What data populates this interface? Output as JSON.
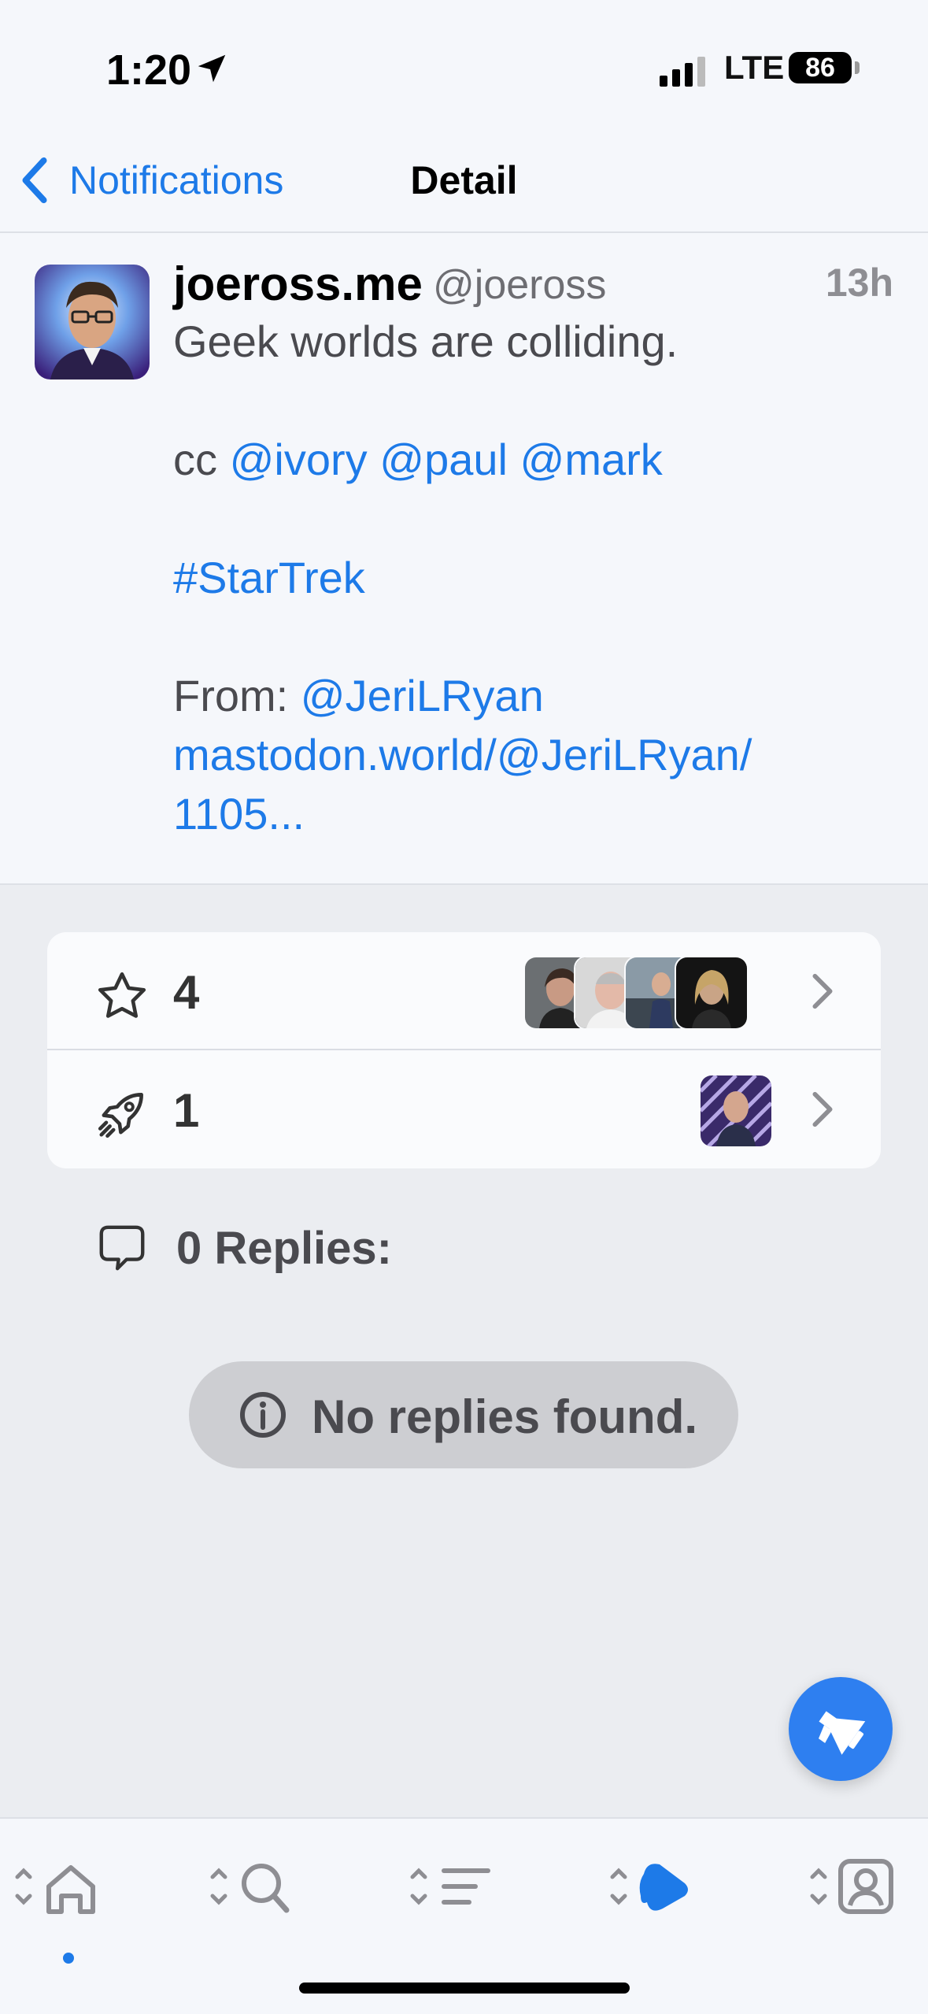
{
  "status_bar": {
    "time": "1:20",
    "network": "LTE",
    "battery": "86"
  },
  "nav": {
    "back_label": "Notifications",
    "title": "Detail"
  },
  "post": {
    "display_name": "joeross.me",
    "handle": "@joeross",
    "timestamp": "13h",
    "lines": [
      [
        {
          "text": "Geek worlds are colliding.",
          "link": false
        }
      ],
      [],
      [
        {
          "text": "cc ",
          "link": false
        },
        {
          "text": "@ivory",
          "link": true
        },
        {
          "text": " ",
          "link": false
        },
        {
          "text": "@paul",
          "link": true
        },
        {
          "text": " ",
          "link": false
        },
        {
          "text": "@mark",
          "link": true
        }
      ],
      [],
      [
        {
          "text": "#StarTrek",
          "link": true
        }
      ],
      [],
      [
        {
          "text": "From: ",
          "link": false
        },
        {
          "text": "@JeriLRyan",
          "link": true
        }
      ],
      [
        {
          "text": "mastodon.world/@JeriLRyan/",
          "link": true
        }
      ],
      [
        {
          "text": "1105...",
          "link": true
        }
      ]
    ]
  },
  "interactions": {
    "favorites": {
      "count": "4",
      "icon": "star-icon"
    },
    "boosts": {
      "count": "1",
      "icon": "rocket-icon"
    }
  },
  "replies": {
    "label": "0 Replies:",
    "empty_message": "No replies found."
  },
  "tabs": [
    {
      "name": "home",
      "icon": "home-icon",
      "active_dot": true
    },
    {
      "name": "search",
      "icon": "search-icon",
      "active_dot": false
    },
    {
      "name": "lists",
      "icon": "list-icon",
      "active_dot": false
    },
    {
      "name": "notifications",
      "icon": "notification-icon",
      "active_dot": false
    },
    {
      "name": "profile",
      "icon": "profile-icon",
      "active_dot": false
    }
  ],
  "colors": {
    "accent": "#1d7ae8",
    "fab": "#2e7ff0",
    "background": "#f5f7fb",
    "section_background": "#ebedf1"
  }
}
